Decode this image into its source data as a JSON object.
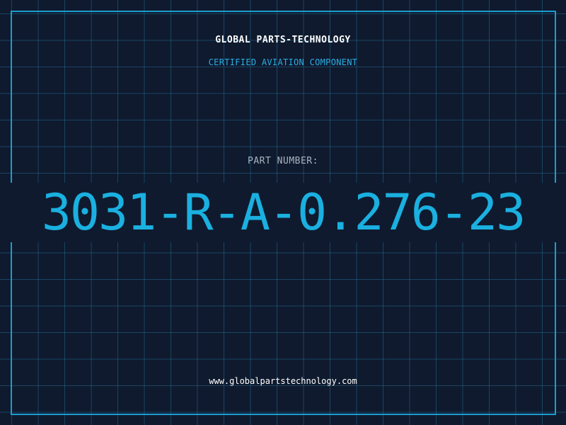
{
  "header": {
    "company_name": "GLOBAL PARTS-TECHNOLOGY",
    "subtitle": "CERTIFIED AVIATION COMPONENT"
  },
  "part": {
    "label": "PART NUMBER:",
    "number": "3031-R-A-0.276-23"
  },
  "footer": {
    "website": "www.globalpartstechnology.com"
  },
  "colors": {
    "background": "#0f1a2e",
    "grid": "#28789f",
    "frame": "#1c9dd0",
    "accent": "#1ab0e0",
    "label": "#a9b4c2"
  }
}
